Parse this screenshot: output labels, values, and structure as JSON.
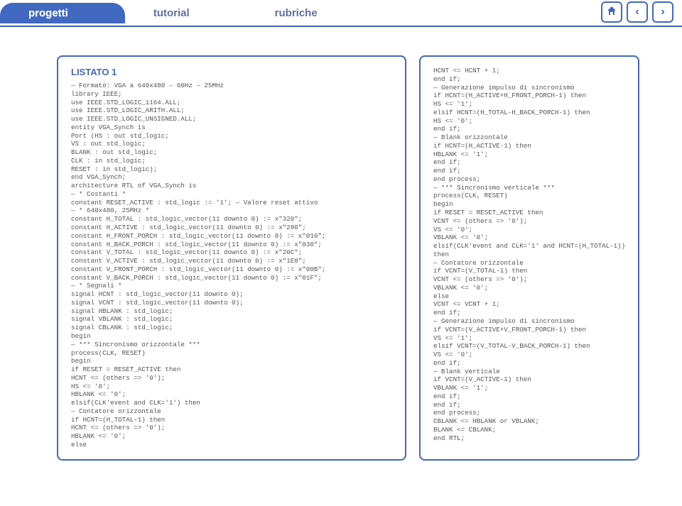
{
  "header": {
    "tabs": [
      {
        "label": "progetti",
        "active": true
      },
      {
        "label": "tutorial",
        "active": false
      },
      {
        "label": "rubriche",
        "active": false
      }
    ]
  },
  "listing": {
    "title": "LISTATO 1",
    "code_left": "— Formato: VGA a 640x480 – 60Hz – 25MHz\nlibrary IEEE;\nuse IEEE.STD_LOGIC_1164.ALL;\nuse IEEE.STD_LOGIC_ARITH.ALL;\nuse IEEE.STD_LOGIC_UNSIGNED.ALL;\nentity VGA_Synch is\nPort (HS : out std_logic;\nVS : out std_logic;\nBLANK : out std_logic;\nCLK : in std_logic;\nRESET : in std_logic);\nend VGA_Synch;\narchitecture RTL of VGA_Synch is\n— * Costanti *\nconstant RESET_ACTIVE : std_logic := '1'; — Valore reset attivo\n— * 640x480, 25MHz *\nconstant H_TOTAL : std_logic_vector(11 downto 0) := x\"320\";\nconstant H_ACTIVE : std_logic_vector(11 downto 0) := x\"280\";\nconstant H_FRONT_PORCH : std_logic_vector(11 downto 0) := x\"010\";\nconstant H_BACK_PORCH : std_logic_vector(11 downto 0) := x\"030\";\nconstant V_TOTAL : std_logic_vector(11 downto 0) := x\"20C\";\nconstant V_ACTIVE : std_logic_vector(11 downto 0) := x\"1E0\";\nconstant V_FRONT_PORCH : std_logic_vector(11 downto 0) := x\"00B\";\nconstant V_BACK_PORCH : std_logic_vector(11 downto 0) := x\"01F\";\n— * Segnali *\nsignal HCNT : std_logic_vector(11 downto 0);\nsignal VCNT : std_logic_vector(11 downto 0);\nsignal HBLANK : std_logic;\nsignal VBLANK : std_logic;\nsignal CBLANK : std_logic;\nbegin\n— *** Sincronismo orizzontale ***\nprocess(CLK, RESET)\nbegin\nif RESET = RESET_ACTIVE then\nHCNT <= (others => '0');\nHS <= '0';\nHBLANK <= '0';\nelsif(CLK'event and CLK='1') then\n— Contatore orizzontale\nif HCNT=(H_TOTAL-1) then\nHCNT <= (others => '0');\nHBLANK <= '0';\nelse",
    "code_right": "HCNT <= HCNT + 1;\nend if;\n— Generazione impulso di sincronismo\nif HCNT=(H_ACTIVE+H_FRONT_PORCH-1) then\nHS <= '1';\nelsif HCNT=(H_TOTAL-H_BACK_PORCH-1) then\nHS <= '0';\nend if;\n— Blank orizzontale\nif HCNT=(H_ACTIVE-1) then\nHBLANK <= '1';\nend if;\nend if;\nend process;\n— *** Sincronismo verticale ***\nprocess(CLK, RESET)\nbegin\nif RESET = RESET_ACTIVE then\nVCNT <= (others => '0');\nVS <= '0';\nVBLANK <= '0';\nelsif(CLK'event and CLK='1' and HCNT=(H_TOTAL-1))\nthen\n— Contatore orizzontale\nif VCNT=(V_TOTAL-1) then\nVCNT <= (others => '0');\nVBLANK <= '0';\nelse\nVCNT <= VCNT + 1;\nend if;\n— Generazione impulso di sincronismo\nif VCNT=(V_ACTIVE+V_FRONT_PORCH-1) then\nVS <= '1';\nelsif VCNT=(V_TOTAL-V_BACK_PORCH-1) then\nVS <= '0';\nend if;\n— Blank verticale\nif VCNT=(V_ACTIVE-1) then\nVBLANK <= '1';\nend if;\nend if;\nend process;\nCBLANK <= HBLANK or VBLANK;\nBLANK <= CBLANK;\nend RTL;"
  }
}
